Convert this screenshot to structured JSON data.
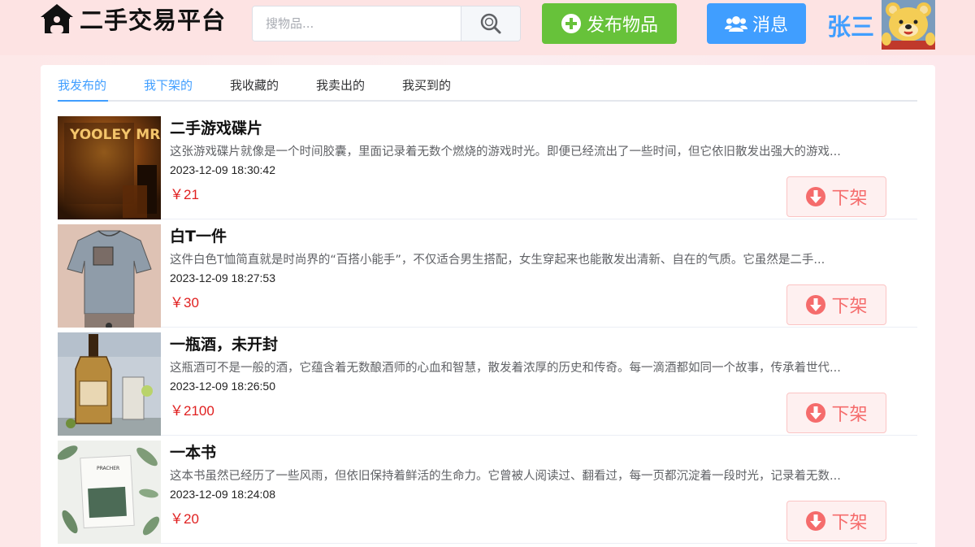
{
  "header": {
    "site_title": "二手交易平台",
    "search_placeholder": "搜物品...",
    "publish_label": "发布物品",
    "message_label": "消息",
    "username": "张三"
  },
  "tabs": [
    {
      "label": "我发布的",
      "active": true
    },
    {
      "label": "我下架的",
      "active": false
    },
    {
      "label": "我收藏的",
      "active": false
    },
    {
      "label": "我卖出的",
      "active": false
    },
    {
      "label": "我买到的",
      "active": false
    }
  ],
  "items": [
    {
      "title": "二手游戏碟片",
      "description": "这张游戏碟片就像是一个时间胶囊，里面记录着无数个燃烧的游戏时光。即便已经流出了一些时间，但它依旧散发出强大的游戏...",
      "time": "2023-12-09 18:30:42",
      "price": "￥21",
      "action_label": "下架",
      "image_text": "YOOLEY MRBIEM"
    },
    {
      "title": "白T一件",
      "description": "这件白色T恤简直就是时尚界的“百搭小能手”，不仅适合男生搭配，女生穿起来也能散发出清新、自在的气质。它虽然是二手...",
      "time": "2023-12-09 18:27:53",
      "price": "￥30",
      "action_label": "下架"
    },
    {
      "title": "一瓶酒，未开封",
      "description": "这瓶酒可不是一般的酒，它蕴含着无数酿酒师的心血和智慧，散发着浓厚的历史和传奇。每一滴酒都如同一个故事，传承着世代...",
      "time": "2023-12-09 18:26:50",
      "price": "￥2100",
      "action_label": "下架"
    },
    {
      "title": "一本书",
      "description": "这本书虽然已经历了一些风雨，但依旧保持着鲜活的生命力。它曾被人阅读过、翻看过，每一页都沉淀着一段时光，记录着无数...",
      "time": "2023-12-09 18:24:08",
      "price": "￥20",
      "action_label": "下架",
      "image_text": "PRACHER"
    }
  ],
  "colors": {
    "primary": "#409eff",
    "success": "#67c23a",
    "danger": "#f56c6c",
    "price": "#e02020"
  }
}
